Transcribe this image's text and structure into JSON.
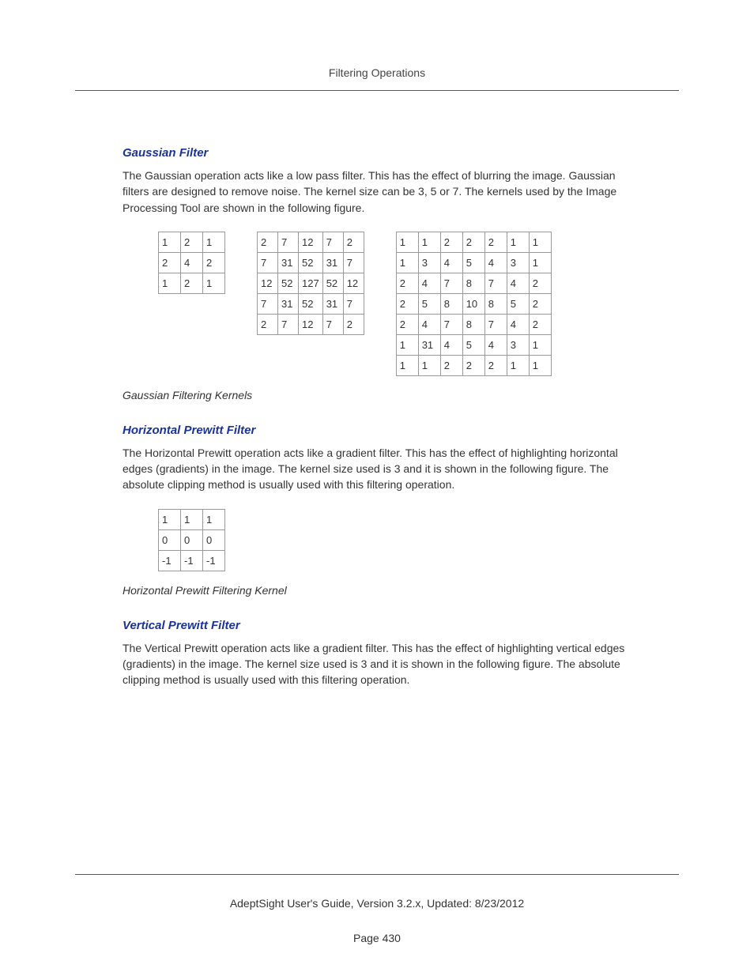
{
  "header": {
    "title": "Filtering Operations"
  },
  "sections": {
    "gaussian": {
      "heading": "Gaussian Filter",
      "paragraph": "The Gaussian operation acts like a low pass filter. This has the effect of blurring the image. Gaussian filters are designed to remove noise. The kernel size can be 3, 5 or 7. The kernels used by the Image Processing Tool are shown in the following figure.",
      "caption": "Gaussian Filtering Kernels"
    },
    "hprewitt": {
      "heading": "Horizontal Prewitt Filter",
      "paragraph": "The Horizontal Prewitt operation acts like a gradient filter. This has the effect of highlighting horizontal edges (gradients) in the image. The kernel size used is 3 and it is shown in the following figure. The absolute clipping method is usually used with this filtering operation.",
      "caption": "Horizontal Prewitt Filtering Kernel"
    },
    "vprewitt": {
      "heading": "Vertical Prewitt Filter",
      "paragraph": "The Vertical Prewitt operation acts like a gradient filter. This has the effect of highlighting vertical edges (gradients) in the image. The kernel size used is 3 and it is shown in the following figure.  The absolute clipping method is usually used with this filtering operation."
    }
  },
  "chart_data": [
    {
      "type": "table",
      "title": "Gaussian 3x3 kernel",
      "rows": [
        [
          "1",
          "2",
          "1"
        ],
        [
          "2",
          "4",
          "2"
        ],
        [
          "1",
          "2",
          "1"
        ]
      ]
    },
    {
      "type": "table",
      "title": "Gaussian 5x5 kernel",
      "rows": [
        [
          "2",
          "7",
          "12",
          "7",
          "2"
        ],
        [
          "7",
          "31",
          "52",
          "31",
          "7"
        ],
        [
          "12",
          "52",
          "127",
          "52",
          "12"
        ],
        [
          "7",
          "31",
          "52",
          "31",
          "7"
        ],
        [
          "2",
          "7",
          "12",
          "7",
          "2"
        ]
      ]
    },
    {
      "type": "table",
      "title": "Gaussian 7x7 kernel",
      "rows": [
        [
          "1",
          "1",
          "2",
          "2",
          "2",
          "1",
          "1"
        ],
        [
          "1",
          "3",
          "4",
          "5",
          "4",
          "3",
          "1"
        ],
        [
          "2",
          "4",
          "7",
          "8",
          "7",
          "4",
          "2"
        ],
        [
          "2",
          "5",
          "8",
          "10",
          "8",
          "5",
          "2"
        ],
        [
          "2",
          "4",
          "7",
          "8",
          "7",
          "4",
          "2"
        ],
        [
          "1",
          "31",
          "4",
          "5",
          "4",
          "3",
          "1"
        ],
        [
          "1",
          "1",
          "2",
          "2",
          "2",
          "1",
          "1"
        ]
      ]
    },
    {
      "type": "table",
      "title": "Horizontal Prewitt 3x3 kernel",
      "rows": [
        [
          "1",
          "1",
          "1"
        ],
        [
          "0",
          "0",
          "0"
        ],
        [
          "-1",
          "-1",
          "-1"
        ]
      ]
    }
  ],
  "footer": {
    "line1": "AdeptSight User's Guide,  Version 3.2.x, Updated: 8/23/2012",
    "line2": "Page 430"
  }
}
